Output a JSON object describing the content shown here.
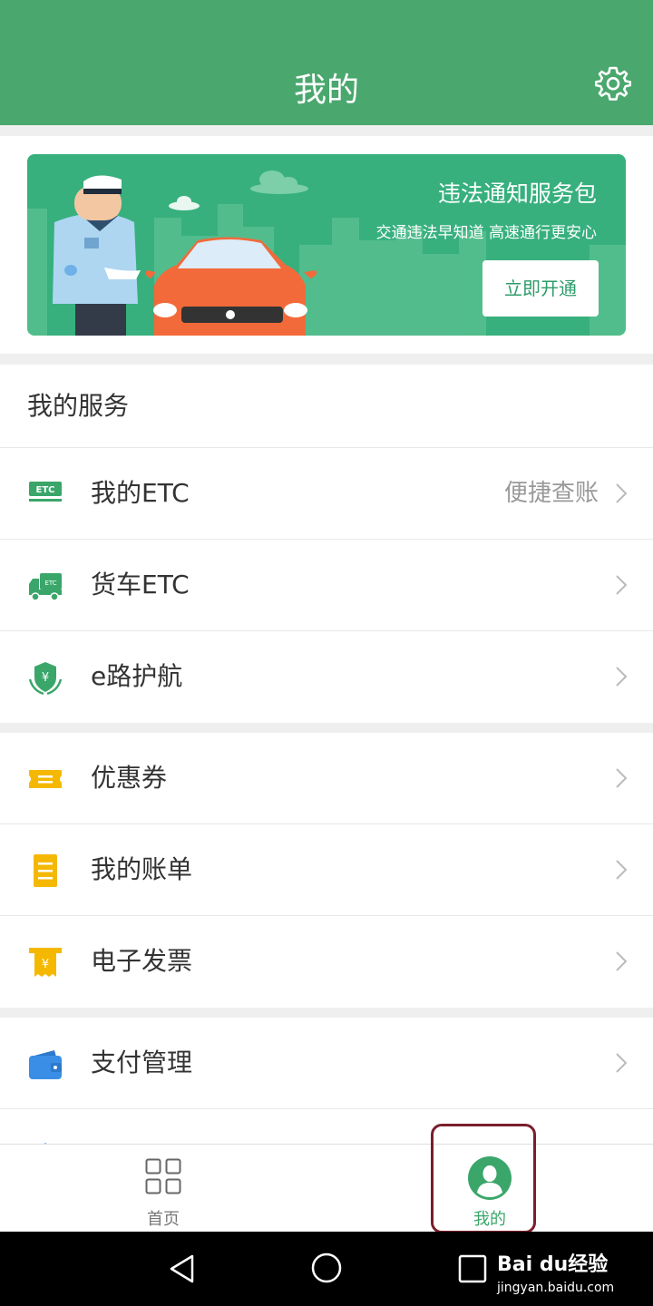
{
  "header": {
    "title": "我的"
  },
  "banner": {
    "title": "违法通知服务包",
    "subtitle": "交通违法早知道 高速通行更安心",
    "button": "立即开通"
  },
  "my_services": {
    "heading": "我的服务",
    "items": [
      {
        "label": "我的ETC",
        "extra": "便捷查账",
        "icon": "etc-card-icon"
      },
      {
        "label": "货车ETC",
        "extra": "",
        "icon": "truck-icon"
      },
      {
        "label": "e路护航",
        "extra": "",
        "icon": "shield-yuan-icon"
      }
    ]
  },
  "finance": {
    "items": [
      {
        "label": "优惠券",
        "icon": "coupon-icon"
      },
      {
        "label": "我的账单",
        "icon": "bill-icon"
      },
      {
        "label": "电子发票",
        "icon": "invoice-icon"
      }
    ]
  },
  "payment": {
    "items": [
      {
        "label": "支付管理",
        "icon": "wallet-icon"
      }
    ]
  },
  "tabbar": {
    "tabs": [
      {
        "label": "首页",
        "icon": "grid-icon",
        "active": false
      },
      {
        "label": "我的",
        "icon": "person-icon",
        "active": true
      }
    ]
  },
  "watermark": {
    "brand": "Bai du经验",
    "url": "jingyan.baidu.com"
  },
  "colors": {
    "primary": "#4aa76e",
    "banner": "#37b07e",
    "orange_icon": "#f5b800",
    "blue_icon": "#3a8ee6",
    "highlight": "#7a1e2c"
  }
}
